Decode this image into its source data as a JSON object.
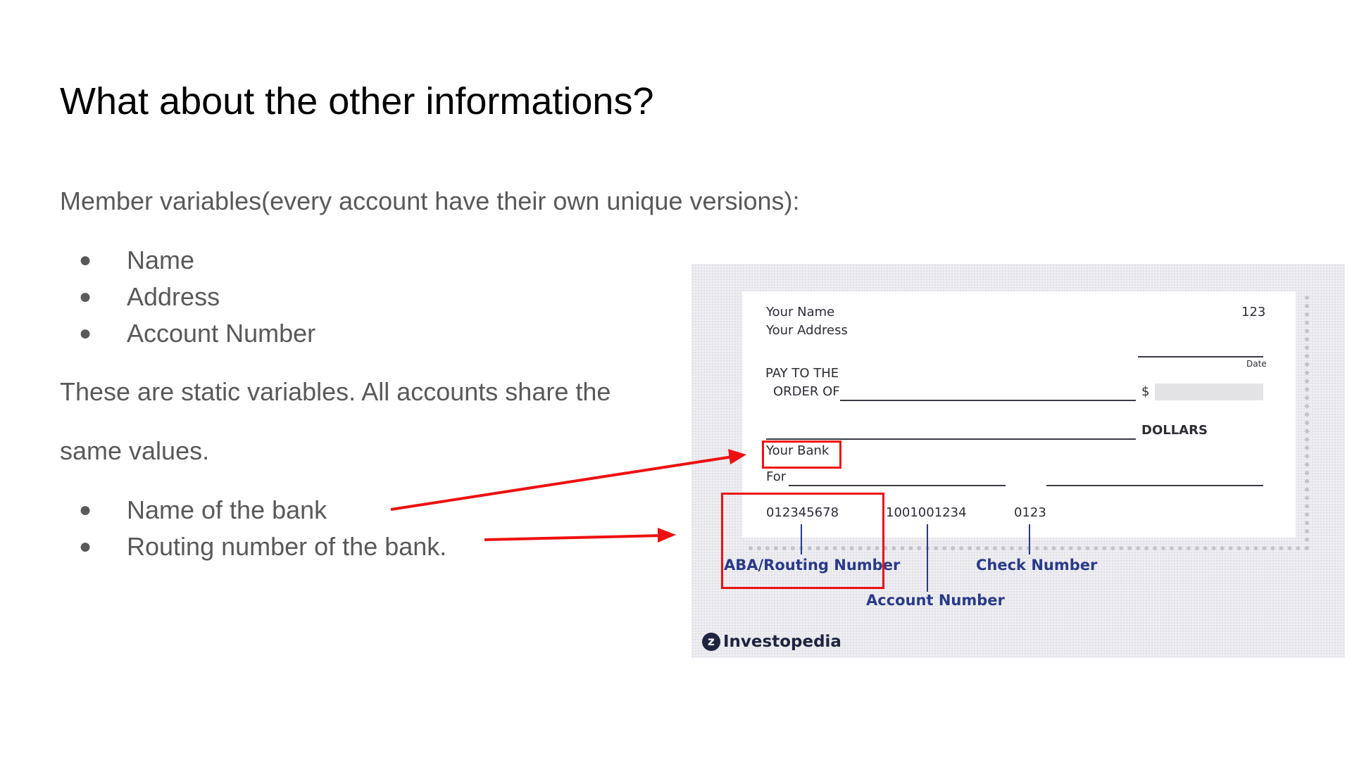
{
  "slide": {
    "title": "What about the other informations?",
    "intro": "Member variables(every account have their own unique versions):",
    "member_bullets": [
      "Name",
      "Address",
      "Account Number"
    ],
    "static_text_line1": "These are static variables. All accounts share the",
    "static_text_line2": "same values.",
    "static_bullets": [
      "Name of the bank",
      "Routing number of the bank."
    ],
    "bullet_glyph": "●"
  },
  "check": {
    "name": "Your Name",
    "address": "Your Address",
    "check_no": "123",
    "date_label": "Date",
    "pay_line1": "PAY TO THE",
    "pay_line2": "ORDER OF",
    "dollar_sign": "$",
    "dollars": "DOLLARS",
    "bank": "Your Bank",
    "for_label": "For",
    "routing": "012345678",
    "account": "1001001234",
    "check_code": "0123",
    "label_routing": "ABA/Routing Number",
    "label_check": "Check Number",
    "label_account": "Account Number",
    "logo_mark": "z",
    "logo_text": "Investopedia"
  },
  "colors": {
    "highlight_red": "#ee1111",
    "label_blue": "#2a3a8a"
  }
}
